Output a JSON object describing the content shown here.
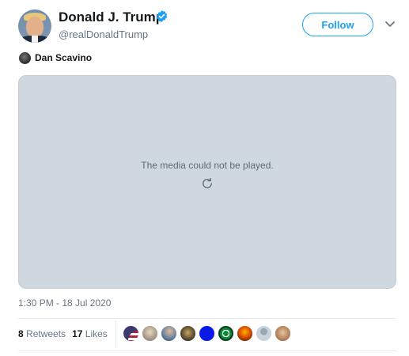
{
  "tweet": {
    "author": {
      "name": "Donald J. Trump",
      "handle": "@realDonaldTrump",
      "verified": true
    },
    "follow_label": "Follow",
    "tagged_user": "Dan Scavino",
    "media": {
      "message": "The media could not be played."
    },
    "timestamp": "1:30 PM - 18 Jul 2020",
    "stats": {
      "retweets_count": "8",
      "retweets_label": "Retweets",
      "likes_count": "17",
      "likes_label": "Likes"
    }
  },
  "colors": {
    "accent": "#1da1f2",
    "media_bg": "#cfd8df",
    "muted_text": "#657786"
  },
  "icons": [
    "verified-badge-icon",
    "chevron-down-icon",
    "reload-icon"
  ]
}
